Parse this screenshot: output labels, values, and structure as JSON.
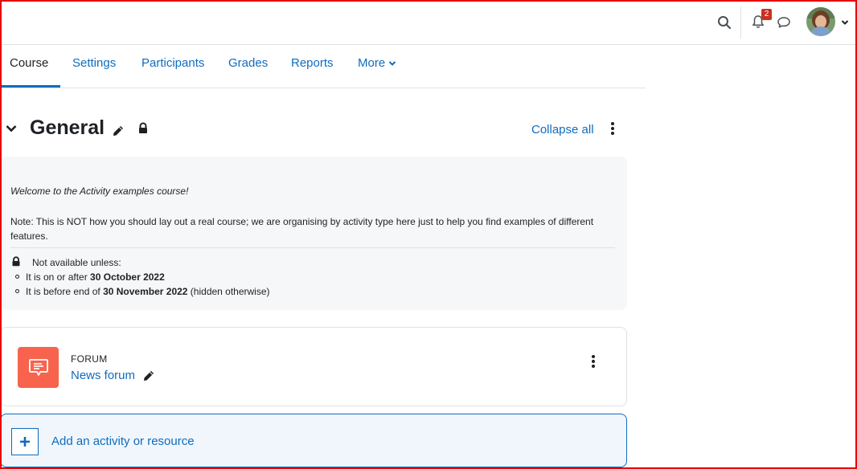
{
  "header": {
    "notifications_count": "2",
    "icons": [
      "search-icon",
      "bell-icon",
      "chat-icon",
      "avatar",
      "chevron-down-icon"
    ]
  },
  "tabs": [
    {
      "label": "Course",
      "active": true
    },
    {
      "label": "Settings"
    },
    {
      "label": "Participants"
    },
    {
      "label": "Grades"
    },
    {
      "label": "Reports"
    },
    {
      "label": "More"
    }
  ],
  "section": {
    "title": "General",
    "collapse_all_label": "Collapse all",
    "summary": {
      "welcome": "Welcome to the Activity examples course!",
      "note": "Note: This is NOT how you should lay out a real course; we are organising by activity type here just to help you find examples of different features.",
      "restriction_heading": "Not available unless:",
      "conditions": [
        {
          "prefix": "It is on or after ",
          "date": "30 October 2022",
          "suffix": ""
        },
        {
          "prefix": "It is before end of ",
          "date": "30 November 2022",
          "suffix": " (hidden otherwise)"
        }
      ]
    }
  },
  "activity": {
    "type": "FORUM",
    "name": "News forum",
    "icon_color": "#f7634d"
  },
  "add_activity_label": "Add an activity or resource",
  "colors": {
    "link": "#0f6cbf",
    "text": "#1d2125",
    "border": "#dee2e6",
    "summary_bg": "#f5f7f9",
    "badge": "#ca3120",
    "frame": "#e60000"
  }
}
